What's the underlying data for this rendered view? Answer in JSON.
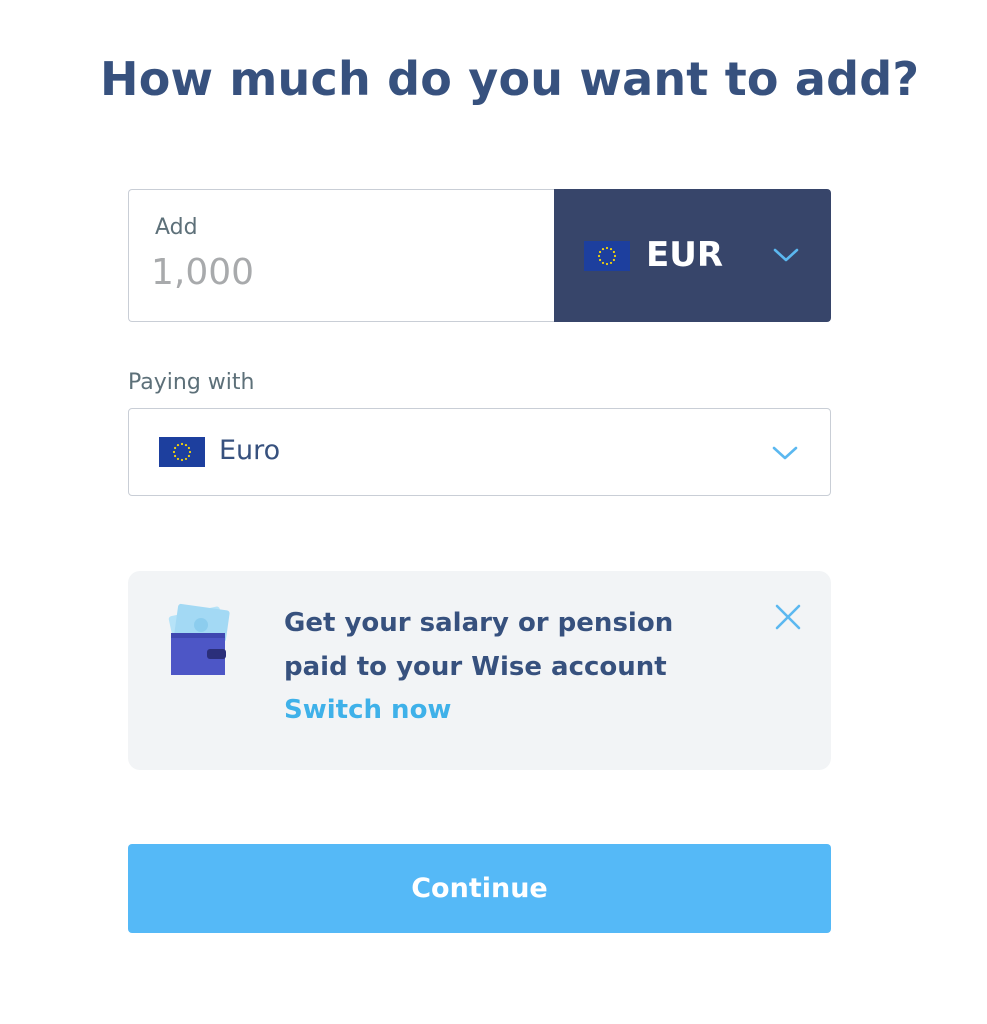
{
  "page": {
    "title": "How much do you want to add?"
  },
  "amount": {
    "label": "Add",
    "placeholder": "1,000",
    "value": ""
  },
  "currency": {
    "code": "EUR",
    "flag_icon": "eu-flag-icon",
    "chevron_icon": "chevron-down-icon"
  },
  "paying_with": {
    "label": "Paying with",
    "value": "Euro",
    "flag_icon": "eu-flag-icon",
    "chevron_icon": "chevron-down-icon"
  },
  "promo": {
    "message": "Get your salary or pension paid to your Wise account",
    "link_label": "Switch now",
    "illustration_icon": "wallet-with-banknotes-icon",
    "close_icon": "close-icon"
  },
  "actions": {
    "continue_label": "Continue"
  },
  "colors": {
    "heading": "#37517e",
    "currency_background": "#37456a",
    "link": "#3fb1e9",
    "primary_button": "#55b9f7",
    "card_background": "#f2f4f6",
    "eu_blue": "#1d3f9e",
    "eu_star": "#f5d30b"
  }
}
